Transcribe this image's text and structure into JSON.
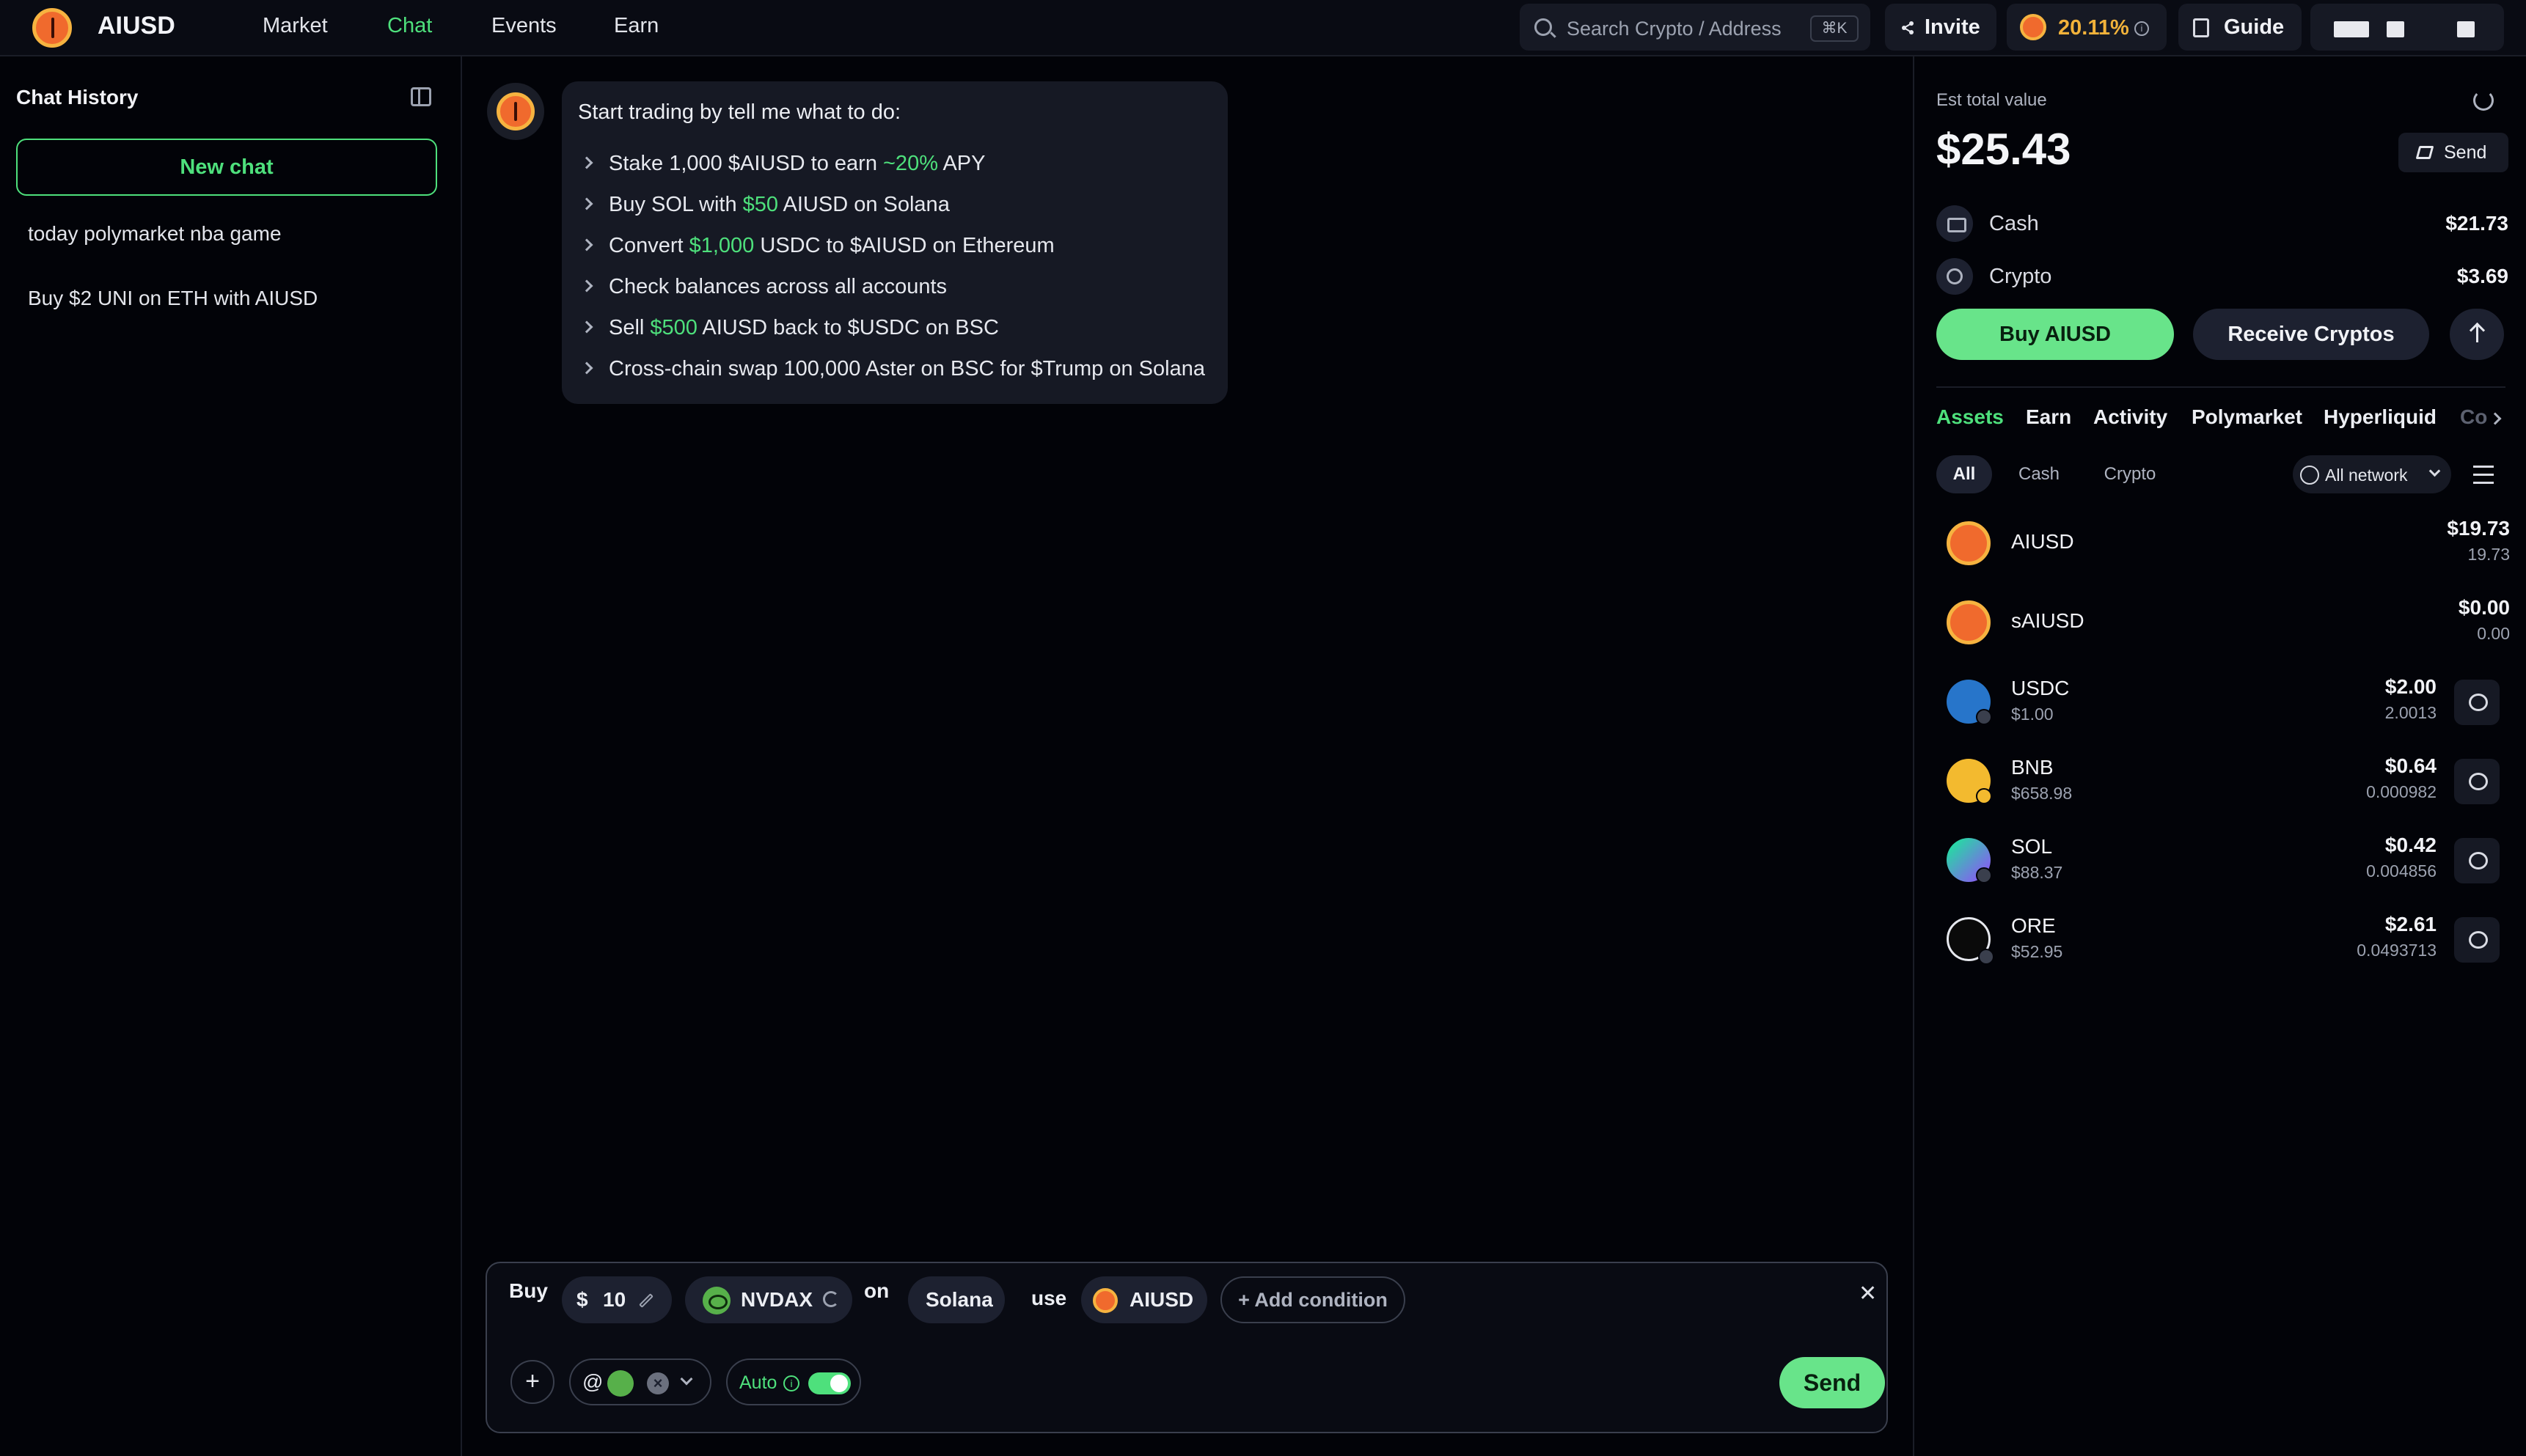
{
  "app": {
    "brand": "AIUSD"
  },
  "nav": {
    "items": [
      "Market",
      "Chat",
      "Events",
      "Earn"
    ],
    "active": "Chat"
  },
  "search": {
    "placeholder": "Search Crypto / Address",
    "shortcut": "⌘K"
  },
  "header": {
    "invite_label": "Invite",
    "apy": "20.11%",
    "guide_label": "Guide"
  },
  "sidebar": {
    "title": "Chat History",
    "new_chat_label": "New chat",
    "history": [
      "today polymarket nba game",
      "Buy $2 UNI on ETH with AIUSD"
    ]
  },
  "chat": {
    "intro": "Start trading by tell me what to do:",
    "suggestions": [
      {
        "pre": "Stake 1,000 $AIUSD to earn ",
        "hl": "~20%",
        "post": " APY"
      },
      {
        "pre": "Buy SOL with ",
        "hl": "$50",
        "post": " AIUSD on Solana"
      },
      {
        "pre": "Convert ",
        "hl": "$1,000",
        "post": " USDC to $AIUSD on Ethereum"
      },
      {
        "pre": "Check balances across all accounts",
        "hl": "",
        "post": ""
      },
      {
        "pre": "Sell ",
        "hl": "$500",
        "post": " AIUSD back to $USDC on BSC"
      },
      {
        "pre": "Cross-chain swap 100,000 Aster on BSC for $Trump on Solana",
        "hl": "",
        "post": ""
      }
    ]
  },
  "composer": {
    "action": "Buy",
    "amount_prefix": "$",
    "amount": "10",
    "token": "NVDAX",
    "on_label": "on",
    "chain": "Solana",
    "use_label": "use",
    "pay_token": "AIUSD",
    "add_condition_label": "+ Add condition",
    "close_glyph": "✕",
    "plus_glyph": "+",
    "mention_prefix": "@",
    "auto_label": "Auto",
    "auto_enabled": true,
    "send_label": "Send"
  },
  "wallet": {
    "est_label": "Est total value",
    "total": "$25.43",
    "send_label": "Send",
    "cash_label": "Cash",
    "cash_value": "$21.73",
    "crypto_label": "Crypto",
    "crypto_value": "$3.69",
    "buy_label": "Buy AIUSD",
    "receive_label": "Receive Cryptos",
    "tabs": [
      "Assets",
      "Earn",
      "Activity",
      "Polymarket",
      "Hyperliquid",
      "Co"
    ],
    "active_tab": "Assets",
    "filters": [
      "All",
      "Cash",
      "Crypto"
    ],
    "active_filter": "All",
    "network_label": "All network",
    "assets": [
      {
        "symbol": "AIUSD",
        "price": "",
        "usd": "$19.73",
        "amount": "19.73",
        "icon": "aiusd-coin-icon",
        "color": "#f06a2d"
      },
      {
        "symbol": "sAIUSD",
        "price": "",
        "usd": "$0.00",
        "amount": "0.00",
        "icon": "saiusd-coin-icon",
        "color": "#f06a2d"
      },
      {
        "symbol": "USDC",
        "price": "$1.00",
        "usd": "$2.00",
        "amount": "2.0013",
        "icon": "usdc-coin-icon",
        "color": "#2775ca"
      },
      {
        "symbol": "BNB",
        "price": "$658.98",
        "usd": "$0.64",
        "amount": "0.000982",
        "icon": "bnb-coin-icon",
        "color": "#f3ba2f"
      },
      {
        "symbol": "SOL",
        "price": "$88.37",
        "usd": "$0.42",
        "amount": "0.004856",
        "icon": "sol-coin-icon",
        "color": "#1b1f2c"
      },
      {
        "symbol": "ORE",
        "price": "$52.95",
        "usd": "$2.61",
        "amount": "0.0493713",
        "icon": "ore-coin-icon",
        "color": "#0a0a0a"
      }
    ]
  },
  "colors": {
    "accent": "#4ee07c",
    "button_green": "#68e48a",
    "apy_gold": "#f2b23a",
    "background": "#020308"
  }
}
